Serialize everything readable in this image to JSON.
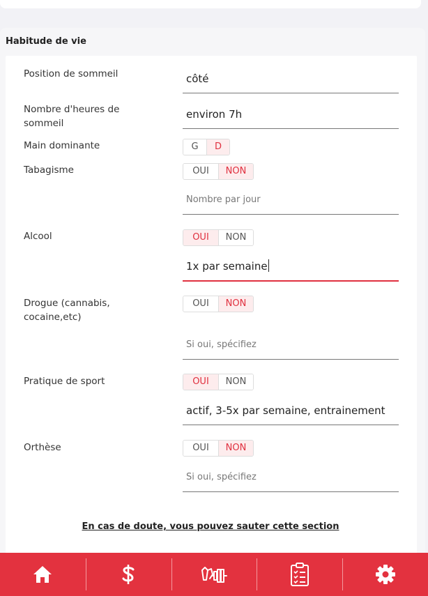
{
  "section": {
    "title": "Habitude de vie"
  },
  "fields": {
    "sommeil_position": {
      "label": "Position de sommeil",
      "value": "côté"
    },
    "sommeil_heures": {
      "label": "Nombre d'heures de sommeil",
      "value": "environ 7h"
    },
    "main_dominante": {
      "label": "Main dominante",
      "options": [
        "G",
        "D"
      ],
      "selected": "D"
    },
    "tabagisme": {
      "label": "Tabagisme",
      "options": [
        "OUI",
        "NON"
      ],
      "selected": "NON",
      "detail_placeholder": "Nombre par jour"
    },
    "alcool": {
      "label": "Alcool",
      "options": [
        "OUI",
        "NON"
      ],
      "selected": "OUI",
      "detail_value": "1x par semaine"
    },
    "drogue": {
      "label": "Drogue (cannabis, cocaine,etc)",
      "options": [
        "OUI",
        "NON"
      ],
      "selected": "NON",
      "detail_placeholder": "Si oui, spécifiez"
    },
    "sport": {
      "label": "Pratique de sport",
      "options": [
        "OUI",
        "NON"
      ],
      "selected": "OUI",
      "detail_value": "actif, 3-5x par semaine, entrainement"
    },
    "orthese": {
      "label": "Orthèse",
      "options": [
        "OUI",
        "NON"
      ],
      "selected": "NON",
      "detail_placeholder": "Si oui, spécifiez"
    }
  },
  "skip_link": "En cas de doute, vous pouvez sauter cette section",
  "bottom_nav": {
    "items": [
      {
        "icon": "home-icon"
      },
      {
        "icon": "dollar-icon"
      },
      {
        "icon": "exercise-icon"
      },
      {
        "icon": "clipboard-checklist-icon"
      },
      {
        "icon": "gear-icon"
      }
    ]
  },
  "colors": {
    "accent": "#e3323f",
    "selected_bg": "#fdeced",
    "selected_text": "#e0303f"
  }
}
